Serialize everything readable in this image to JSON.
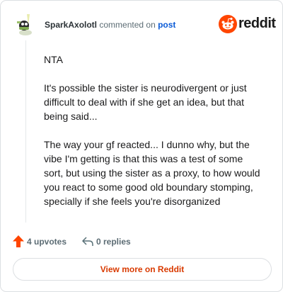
{
  "comment": {
    "username": "SparkAxolotl",
    "action_text": "commented on",
    "post_link": "post",
    "brand": "reddit",
    "paragraphs": [
      "NTA",
      "It's possible the sister is neurodivergent or just difficult to deal with if she get an idea, but that being said...",
      "The way your gf reacted... I dunno why, but the vibe I'm getting is that this was a test of some sort, but using the sister as a proxy, to how would you react to some good old boundary stomping, specially if she feels you're disorganized"
    ],
    "upvotes_label": "4 upvotes",
    "replies_label": "0 replies",
    "view_more_label": "View more on Reddit"
  },
  "colors": {
    "accent": "#d93a00",
    "upvote": "#ff4500",
    "link": "#0a5ad6"
  }
}
